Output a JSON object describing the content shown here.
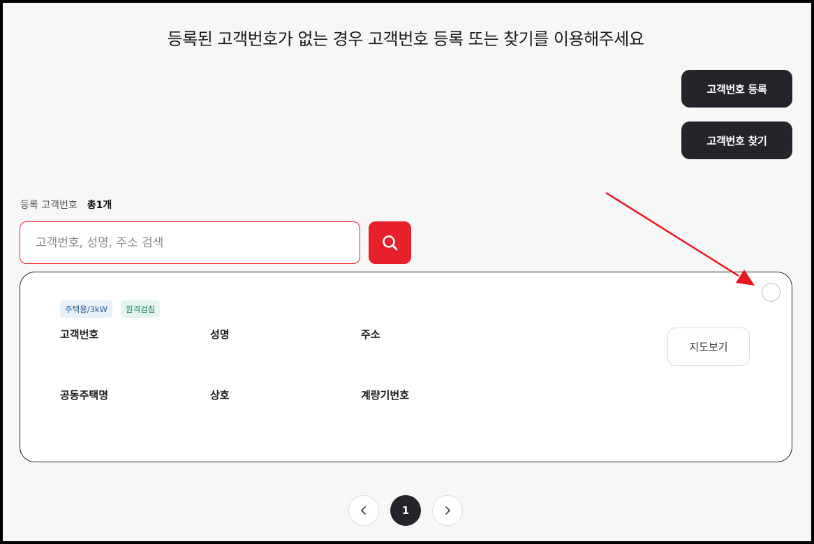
{
  "header": {
    "title": "등록된 고객번호가 없는 경우 고객번호 등록 또는 찾기를 이용해주세요"
  },
  "actions": {
    "register_label": "고객번호 등록",
    "find_label": "고객번호 찾기"
  },
  "list": {
    "count_label": "등록 고객번호",
    "count_value": "총1개"
  },
  "search": {
    "placeholder": "고객번호, 성명, 주소 검색",
    "value": ""
  },
  "card": {
    "badges": [
      "주택용/3kW",
      "원격검침"
    ],
    "fields": {
      "customer_no": "고객번호",
      "name": "성명",
      "address": "주소",
      "apartment": "공동주택명",
      "trade_name": "상호",
      "meter_no": "계량기번호"
    },
    "map_button": "지도보기"
  },
  "pagination": {
    "current": "1"
  },
  "icons": {
    "search": "search-icon",
    "prev": "chevron-left-icon",
    "next": "chevron-right-icon",
    "annotation": "red-arrow"
  },
  "colors": {
    "accent_red": "#e8202b",
    "dark_button": "#23252b",
    "background": "#f7f7f7"
  }
}
